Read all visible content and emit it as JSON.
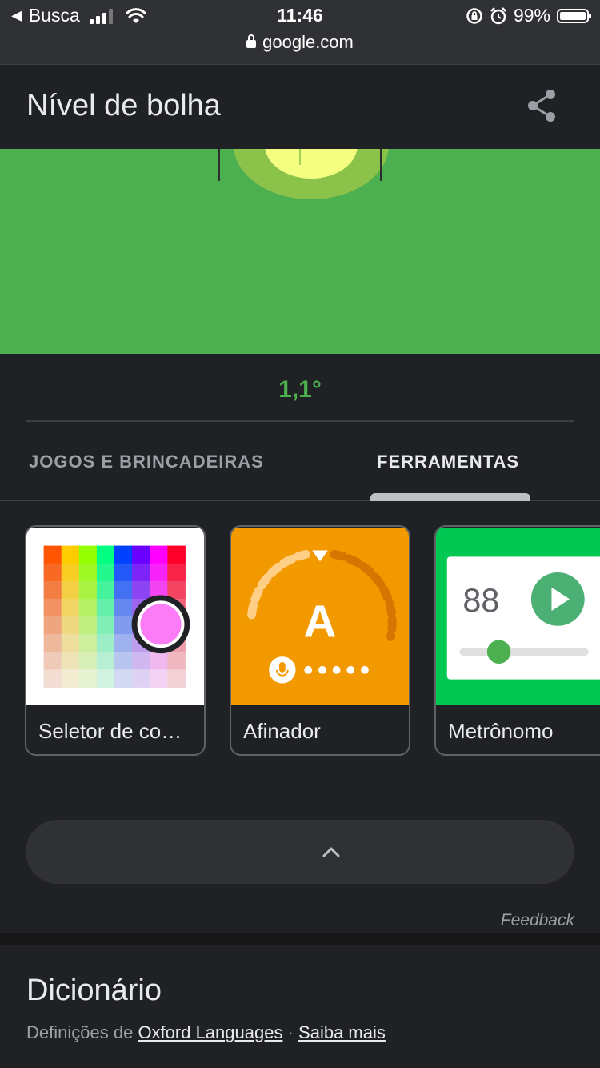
{
  "status_bar": {
    "back_label": "Busca",
    "time": "11:46",
    "url": "google.com",
    "battery": "99%"
  },
  "header": {
    "title": "Nível de bolha"
  },
  "level": {
    "angle": "1,1°"
  },
  "tabs": [
    {
      "label": "JOGOS E BRINCADEIRAS"
    },
    {
      "label": "FERRAMENTAS",
      "active": true
    }
  ],
  "cards": [
    {
      "label": "Seletor de co…"
    },
    {
      "label": "Afinador",
      "art_text": "A"
    },
    {
      "label": "Metrônomo",
      "art_text": "88"
    }
  ],
  "footer": {
    "feedback": "Feedback"
  },
  "dictionary": {
    "title": "Dicionário",
    "prefix": "Definições de",
    "source_link": "Oxford Languages",
    "separator": "·",
    "more_link": "Saiba mais"
  },
  "colors": {
    "accent_green": "#4caf50",
    "background": "#202124",
    "tuner_orange": "#f29900",
    "metronome_green": "#00c853"
  }
}
